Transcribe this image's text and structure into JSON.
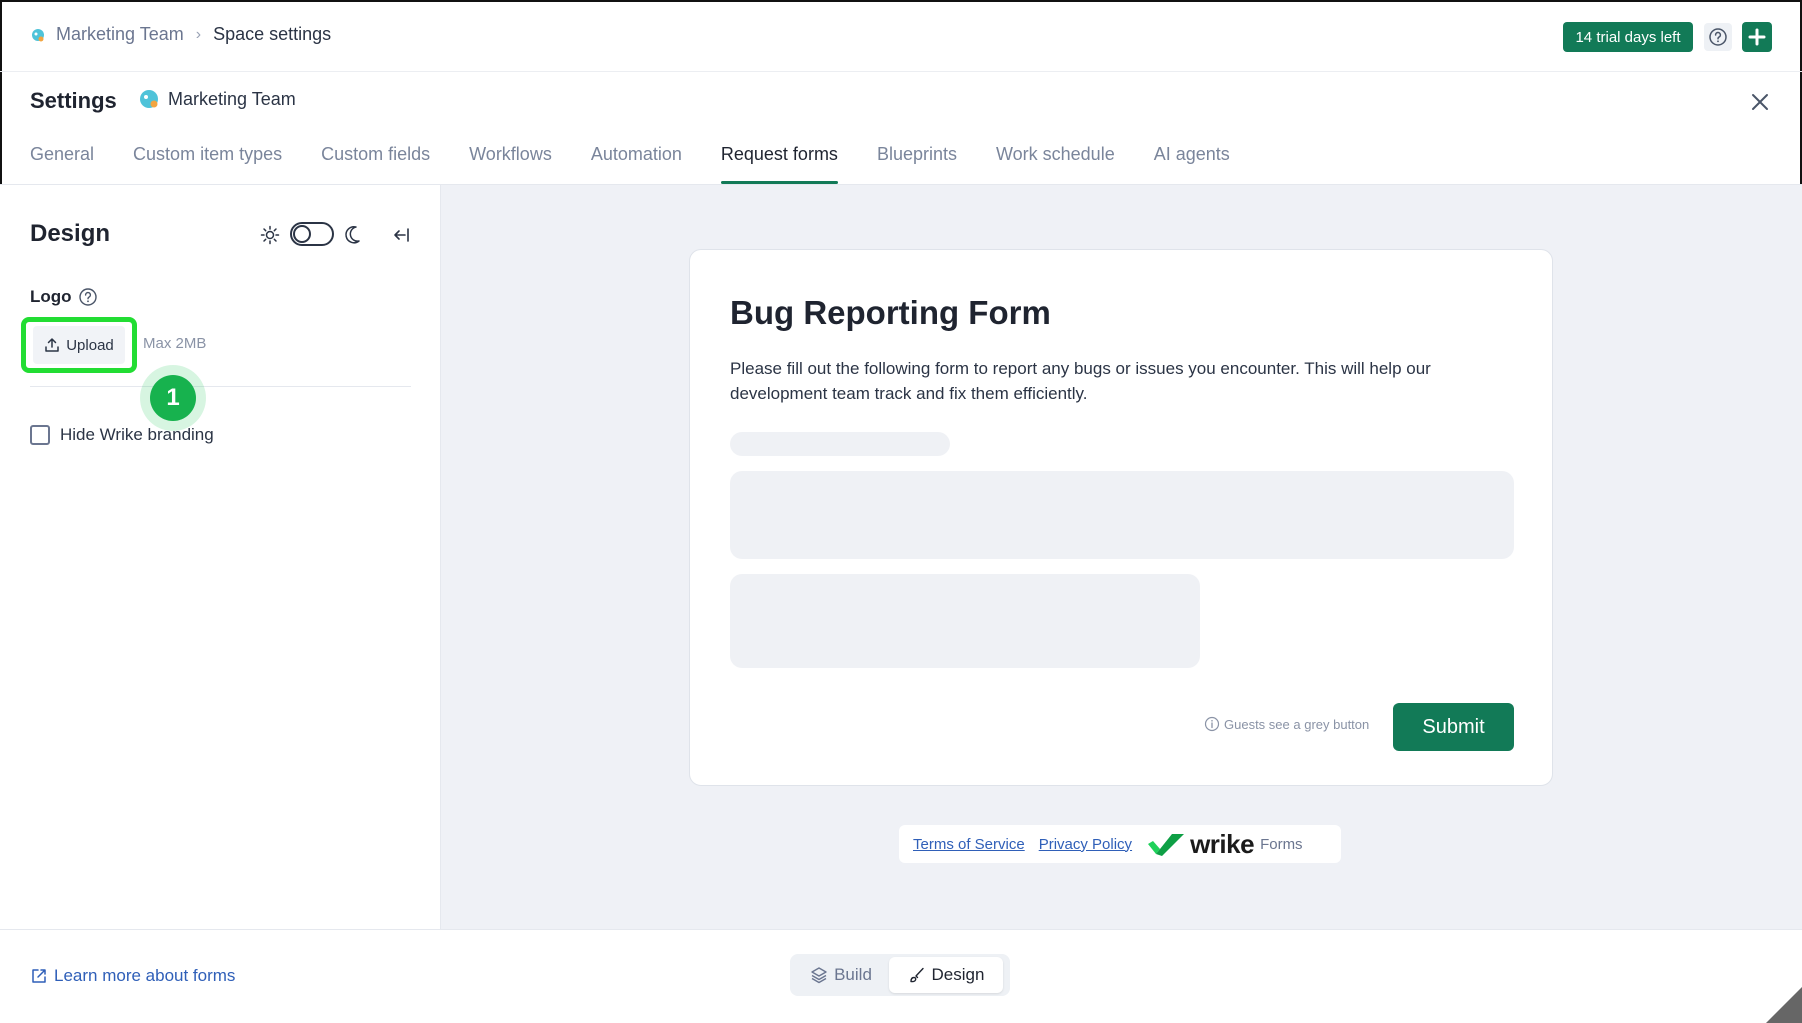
{
  "breadcrumb": {
    "space": "Marketing Team",
    "current": "Space settings"
  },
  "header": {
    "trial_badge": "14 trial days left",
    "help_icon": "question-circle-icon",
    "add_icon": "plus-icon"
  },
  "settings": {
    "title": "Settings",
    "space_name": "Marketing Team"
  },
  "tabs": [
    {
      "label": "General"
    },
    {
      "label": "Custom item types"
    },
    {
      "label": "Custom fields"
    },
    {
      "label": "Workflows"
    },
    {
      "label": "Automation"
    },
    {
      "label": "Request forms",
      "active": true
    },
    {
      "label": "Blueprints"
    },
    {
      "label": "Work schedule"
    },
    {
      "label": "AI agents"
    }
  ],
  "design_panel": {
    "title": "Design",
    "logo_label": "Logo",
    "upload_label": "Upload",
    "max_size": "Max 2MB",
    "step_number": "1",
    "hide_branding_label": "Hide Wrike branding",
    "hide_branding_checked": false
  },
  "form_preview": {
    "title": "Bug Reporting Form",
    "description": "Please fill out the following form to report any bugs or issues you encounter. This will help our development team track and fix them efficiently.",
    "guest_note": "Guests see a grey button",
    "submit_label": "Submit"
  },
  "form_footer": {
    "terms": "Terms of Service",
    "privacy": "Privacy Policy",
    "brand": "wrike",
    "product": "Forms"
  },
  "bottom": {
    "learn_more": "Learn more about forms",
    "modes": [
      "Build",
      "Design"
    ],
    "active_mode": "Design"
  },
  "colors": {
    "accent": "#127a57",
    "highlight": "#22dd33",
    "step_badge": "#17b24e",
    "link": "#2f5fb8"
  }
}
